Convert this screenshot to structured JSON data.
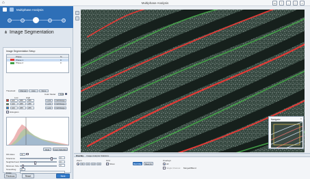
{
  "window": {
    "title": "Multiphase Analysis"
  },
  "module": {
    "title": "Multiphase Analysis"
  },
  "workflow": {
    "steps": 5,
    "active_step": 2
  },
  "section": {
    "title": "Image Segmentation"
  },
  "setup": {
    "title": "Image Segmentation Setup",
    "columns": [
      "Phase",
      "%"
    ],
    "phases": [
      {
        "name": "Phase 1",
        "value": "0",
        "color": "#e53935"
      },
      {
        "name": "Phase 2",
        "value": "0",
        "color": "#43a047"
      }
    ]
  },
  "threshold": {
    "label": "Threshold",
    "modes": [
      "Manual",
      "Auto",
      "None"
    ],
    "color_model_label": "Color Model",
    "color_model": "RGB",
    "min_label": "Low",
    "max_label": "High",
    "channels": [
      {
        "name": "R",
        "low": "100",
        "high": "255",
        "color": "#e53935"
      },
      {
        "name": "G",
        "low": "100",
        "high": "255",
        "color": "#43a047"
      },
      {
        "name": "B",
        "low": "100",
        "high": "255",
        "color": "#1e88e5"
      }
    ],
    "lock_label": "Lock",
    "range_label": "Full Range",
    "histogram_label": "Histogram"
  },
  "options": {
    "fill_holes_label": "Fill Holes",
    "fill_holes_value": "10",
    "tolerance_label": "Tolerance",
    "tolerance_value": "0",
    "neighborhood_label": "Neighborhood",
    "neighborhood_value": "0",
    "minimum_size_label": "Minimum Size",
    "minimum_size_value": "0",
    "smoothing_label": "Smoothing",
    "erase_label": "Erase"
  },
  "buttons": {
    "previous": "Previous",
    "reset": "Reset",
    "next": "Next",
    "small_a": "Clear",
    "small_b": "Invert Selection"
  },
  "navigator": {
    "title": "Navigator"
  },
  "bottom": {
    "tabs": [
      "Overlay",
      "Image Analysis Statistics"
    ],
    "zoom_label": "Zoom",
    "zoom_values": [
      "Fit",
      "1:1",
      "1:2",
      "1:4"
    ],
    "grid_label": "Grid",
    "grid_option": "Show",
    "mode_labels": [
      "Best Map",
      "Best Fit"
    ],
    "overlay_label": "Overlays",
    "overlay_options": [
      "All",
      "Single Channel",
      "Merged/Blend"
    ]
  },
  "colors": {
    "accent": "#2e6fb7",
    "phase_red": "#e53935",
    "phase_green": "#43a047"
  }
}
